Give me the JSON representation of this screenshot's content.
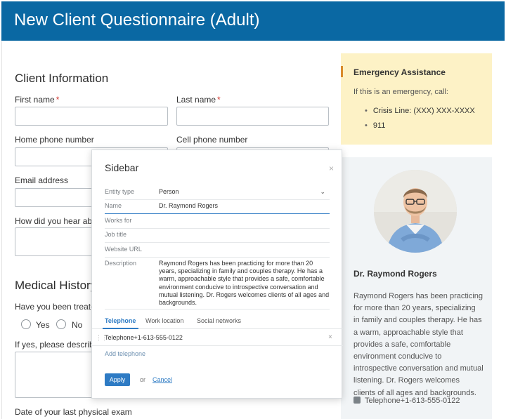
{
  "header": {
    "title": "New Client Questionnaire (Adult)"
  },
  "client_info": {
    "title": "Client Information",
    "first_name_label": "First name",
    "last_name_label": "Last name",
    "required_mark": "*",
    "home_phone_label": "Home phone number",
    "cell_phone_label": "Cell phone number",
    "email_label": "Email address",
    "hear_label": "How did you hear about u"
  },
  "medical": {
    "title": "Medical History",
    "treated_label": "Have you been treated by",
    "yes_label": "Yes",
    "no_label": "No",
    "describe_label": "If yes, please describe the",
    "last_exam_label": "Date of your last physical exam"
  },
  "emergency": {
    "title": "Emergency Assistance",
    "intro": "If this is an emergency, call:",
    "items": [
      "Crisis Line: (XXX) XXX-XXXX",
      "911"
    ]
  },
  "profile": {
    "name": "Dr. Raymond Rogers",
    "description": "Raymond Rogers has been practicing for more than 20 years, specializing in family and couples therapy. He has a warm, approachable style that provides a safe, comfortable environment conducive to introspective conversation and mutual listening. Dr. Rogers welcomes clients of all ages and backgrounds.",
    "phone": "Telephone+1-613-555-0122"
  },
  "modal": {
    "title": "Sidebar",
    "close": "×",
    "fields": {
      "entity_type_label": "Entity type",
      "entity_type_value": "Person",
      "name_label": "Name",
      "name_value": "Dr. Raymond Rogers",
      "works_for_label": "Works for",
      "job_title_label": "Job title",
      "website_label": "Website URL",
      "description_label": "Description",
      "description_value": "Raymond Rogers has been practicing for more than 20 years, specializing in family and couples therapy. He has a warm, approachable style that provides a safe, comfortable environment conducive to introspective conversation and mutual listening. Dr. Rogers welcomes clients of all ages and backgrounds."
    },
    "tabs": [
      "Telephone",
      "Work location",
      "Social networks"
    ],
    "phone_value": "Telephone+1-613-555-0122",
    "add_telephone": "Add telephone",
    "apply": "Apply",
    "or": "or",
    "cancel": "Cancel"
  }
}
